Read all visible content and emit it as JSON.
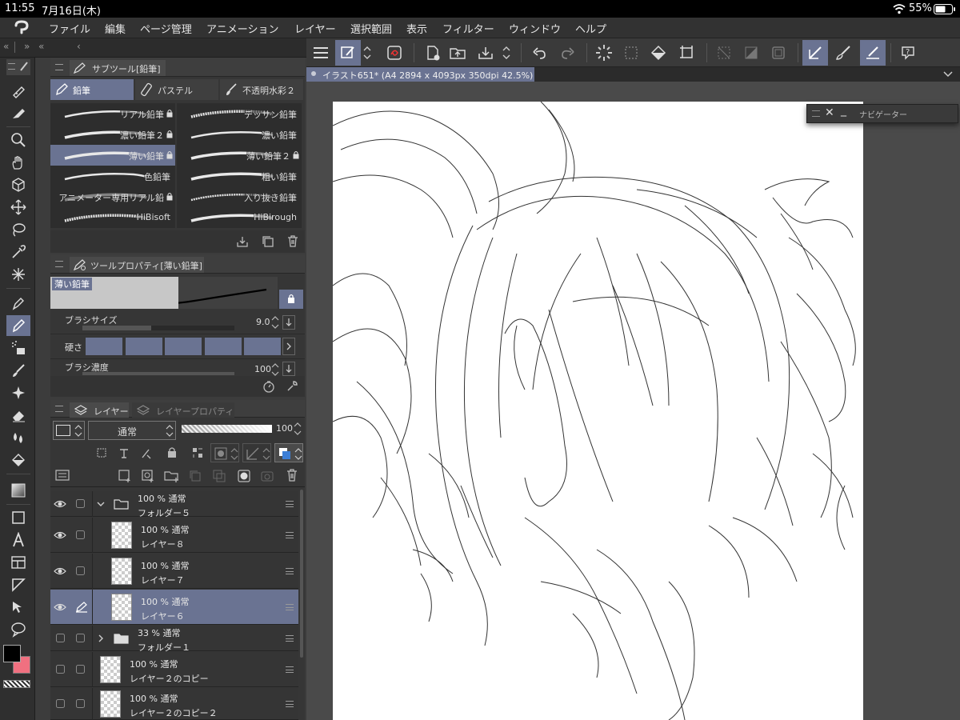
{
  "status": {
    "time": "11:55",
    "date": "7月16日(木)",
    "battery": "55%"
  },
  "menu": {
    "items": [
      "ファイル",
      "編集",
      "ページ管理",
      "アニメーション",
      "レイヤー",
      "選択範囲",
      "表示",
      "フィルター",
      "ウィンドウ",
      "ヘルプ"
    ]
  },
  "document": {
    "tab_label": "イラスト651* (A4 2894 x 4093px 350dpi 42.5%)"
  },
  "navigator": {
    "title": "ナビゲーター"
  },
  "subtool": {
    "title": "サブツール[鉛筆]",
    "tabs": [
      "鉛筆",
      "パステル",
      "不透明水彩２"
    ],
    "brushes": [
      "リアル鉛筆",
      "デッサン鉛筆",
      "濃い鉛筆２",
      "濃い鉛筆",
      "薄い鉛筆",
      "薄い鉛筆２",
      "色鉛筆",
      "粗い鉛筆",
      "アニメーター専用リアル鉛",
      "入り抜き鉛筆",
      "HiBisoft",
      "HiBirough"
    ]
  },
  "toolprop": {
    "title": "ツールプロパティ[薄い鉛筆]",
    "preview_label": "薄い鉛筆",
    "brush_size_label": "ブラシサイズ",
    "brush_size_value": "9.0",
    "hardness_label": "硬さ",
    "density_label": "ブラシ濃度",
    "density_value": "100"
  },
  "layers": {
    "tab_layer": "レイヤー",
    "tab_property": "レイヤープロパティ",
    "blend_mode": "通常",
    "opacity_value": "100",
    "opacity_level": 1.0,
    "items": [
      {
        "line1": "100 % 通常",
        "name": "フォルダー５"
      },
      {
        "line1": "100 % 通常",
        "name": "レイヤー８"
      },
      {
        "line1": "100 % 通常",
        "name": "レイヤー７"
      },
      {
        "line1": "100 % 通常",
        "name": "レイヤー６"
      },
      {
        "line1": "33 % 通常",
        "name": "フォルダー１"
      },
      {
        "line1": "100 % 通常",
        "name": "レイヤー２のコピー"
      },
      {
        "line1": "100 % 通常",
        "name": "レイヤー２のコピー２"
      }
    ]
  },
  "colors": {
    "main": "#000000",
    "sub": "#f07080",
    "accent": "#6a7392"
  }
}
